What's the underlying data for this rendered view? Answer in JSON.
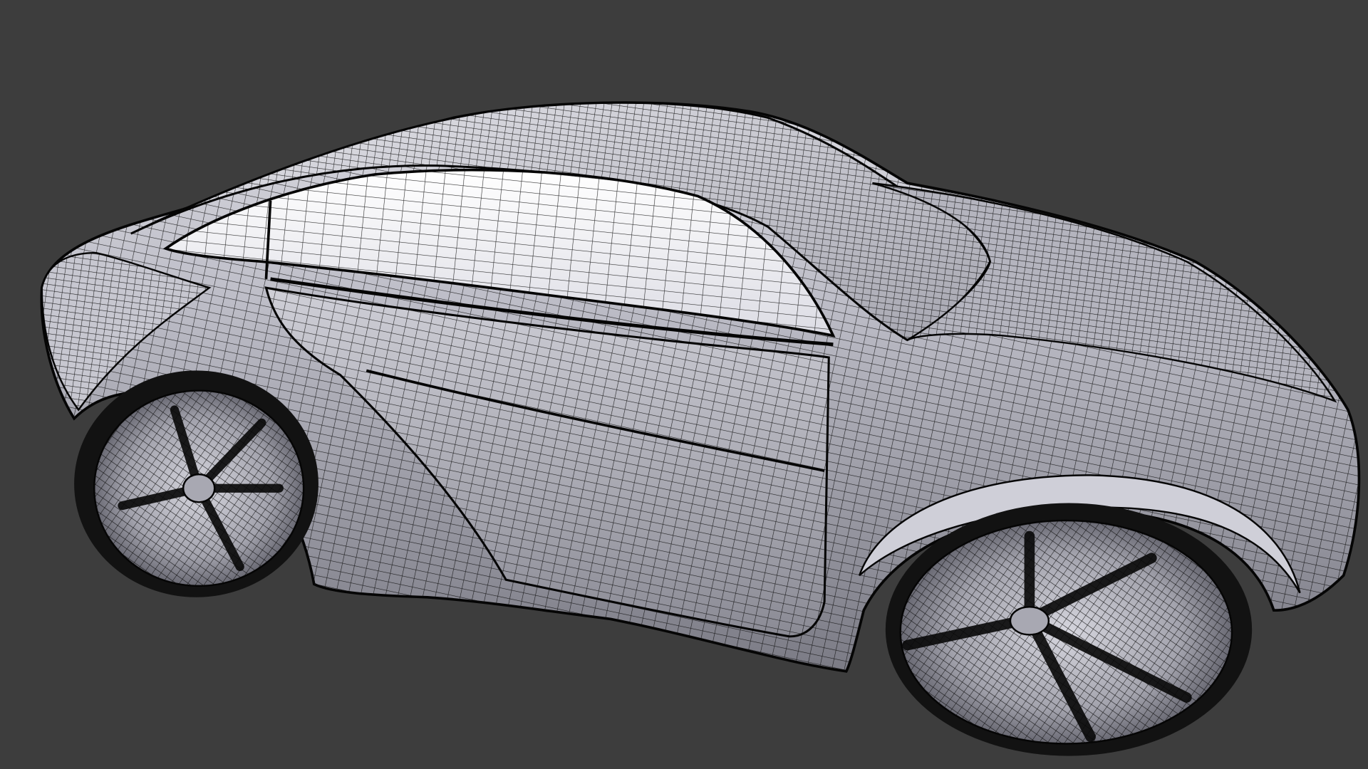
{
  "viewport": {
    "background": "#3d3d3d",
    "display_mode": "wireframe-on-shaded",
    "object": "car-body-mesh"
  },
  "colors": {
    "mesh_shaded_light": "#f2f2f6",
    "mesh_shaded_mid": "#b8b8c2",
    "mesh_shaded_dark": "#6e6e78",
    "wire": "#0a0a0a",
    "glass": "#ffffff",
    "tire": "#121212"
  }
}
